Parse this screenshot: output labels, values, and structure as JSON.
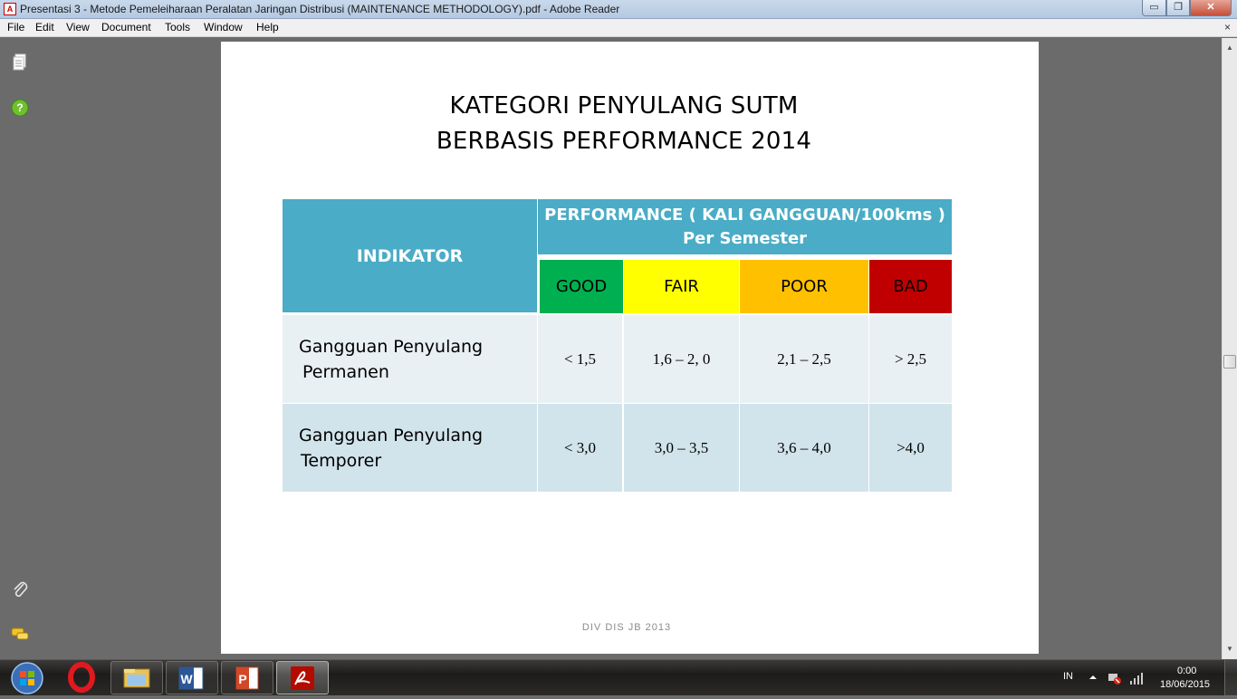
{
  "window": {
    "title": "Presentasi 3 - Metode Pemeleiharaan Peralatan Jaringan Distribusi (MAINTENANCE METHODOLOGY).pdf - Adobe Reader",
    "controls": {
      "minimize": "▭",
      "maximize": "❐",
      "close": "✕"
    }
  },
  "menu": {
    "items": [
      "File",
      "Edit",
      "View",
      "Document",
      "Tools",
      "Window",
      "Help"
    ],
    "close_doc": "×"
  },
  "left_panel": {
    "icons": [
      "pages-icon",
      "help-icon",
      "attachment-icon",
      "comment-icon"
    ]
  },
  "slide": {
    "title_line1": "KATEGORI PENYULANG SUTM",
    "title_line2": "BERBASIS PERFORMANCE 2014",
    "table": {
      "header_indikator": "INDIKATOR",
      "header_perf_line1": "PERFORMANCE ( KALI GANGGUAN/100kms )",
      "header_perf_line2": "Per Semester",
      "ratings": [
        {
          "label": "GOOD",
          "color": "#00b050"
        },
        {
          "label": "FAIR",
          "color": "#ffff00"
        },
        {
          "label": "POOR",
          "color": "#ffc000"
        },
        {
          "label": "BAD",
          "color": "#c00000"
        }
      ],
      "rows": [
        {
          "label_line1": "Gangguan Penyulang",
          "label_line2": "Permanen",
          "values": [
            "<  1,5",
            "1,6 – 2, 0",
            "2,1 – 2,5",
            "> 2,5"
          ]
        },
        {
          "label_line1": "Gangguan Penyulang",
          "label_line2": "Temporer",
          "values": [
            "<  3,0",
            "3,0 – 3,5",
            "3,6 – 4,0",
            ">4,0"
          ]
        }
      ]
    },
    "footer": "DIV DIS JB 2013"
  },
  "taskbar": {
    "apps": [
      "opera-icon",
      "explorer-icon",
      "word-icon",
      "powerpoint-icon",
      "adobe-reader-icon"
    ],
    "language": "IN",
    "time": "0:00",
    "date": "18/06/2015"
  },
  "colors": {
    "teal_header": "#4aacc6",
    "row1_bg": "#e9f0f3",
    "row2_bg": "#d1e3eb"
  }
}
